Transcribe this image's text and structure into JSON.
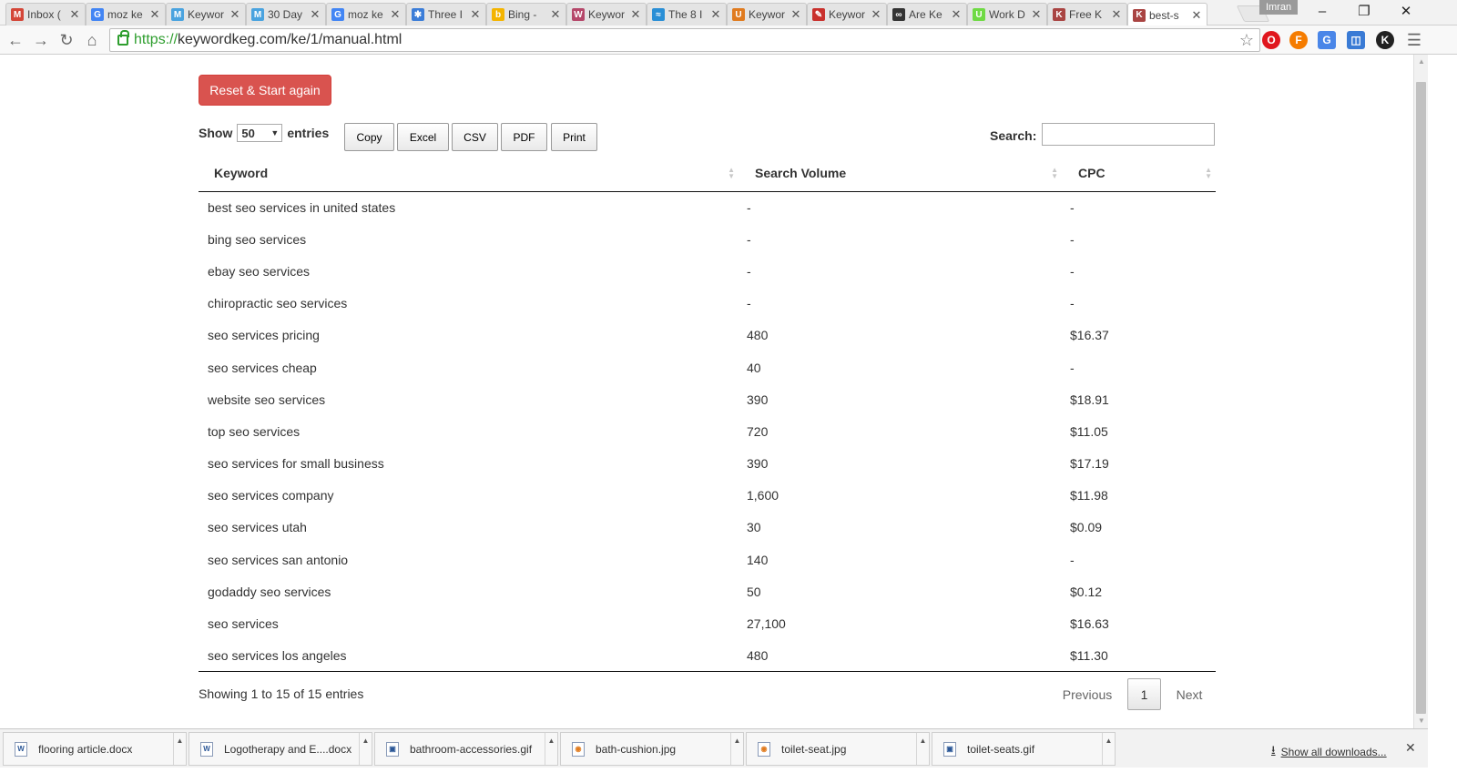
{
  "browser": {
    "tabs": [
      {
        "title": "Inbox (",
        "favicon": "gmail-icon",
        "fav_color": "#d44638",
        "fav_text": "M"
      },
      {
        "title": "moz ke",
        "favicon": "google-icon",
        "fav_color": "#4285f4",
        "fav_text": "G"
      },
      {
        "title": "Keywor",
        "favicon": "moz-icon",
        "fav_color": "#4aa3df",
        "fav_text": "M"
      },
      {
        "title": "30 Day",
        "favicon": "moz-icon",
        "fav_color": "#4aa3df",
        "fav_text": "M"
      },
      {
        "title": "moz ke",
        "favicon": "google-icon",
        "fav_color": "#4285f4",
        "fav_text": "G"
      },
      {
        "title": "Three I",
        "favicon": "gear-icon",
        "fav_color": "#3b7dd8",
        "fav_text": "✱"
      },
      {
        "title": "Bing -",
        "favicon": "bing-icon",
        "fav_color": "#f4b400",
        "fav_text": "b"
      },
      {
        "title": "Keywor",
        "favicon": "ad-icon",
        "fav_color": "#b5476a",
        "fav_text": "W"
      },
      {
        "title": "The 8 I",
        "favicon": "wave-icon",
        "fav_color": "#2a8fd6",
        "fav_text": "≈"
      },
      {
        "title": "Keywor",
        "favicon": "us-icon",
        "fav_color": "#e07b1f",
        "fav_text": "U"
      },
      {
        "title": "Keywor",
        "favicon": "quill-icon",
        "fav_color": "#c9302c",
        "fav_text": "✎"
      },
      {
        "title": "Are Ke",
        "favicon": "dots-icon",
        "fav_color": "#333333",
        "fav_text": "∞"
      },
      {
        "title": "Work D",
        "favicon": "upwork-icon",
        "fav_color": "#6fda44",
        "fav_text": "U"
      },
      {
        "title": "Free K",
        "favicon": "keg-icon",
        "fav_color": "#a94442",
        "fav_text": "K"
      },
      {
        "title": "best-s",
        "favicon": "keg-icon",
        "fav_color": "#a94442",
        "fav_text": "K",
        "active": true
      }
    ],
    "profile_name": "Imran",
    "url_scheme": "https://",
    "url_rest": "keywordkeg.com/ke/1/manual.html"
  },
  "toolbar": {
    "reset_label": "Reset & Start again",
    "show_label": "Show",
    "entries_value": "50",
    "entries_label": "entries",
    "copy_label": "Copy",
    "excel_label": "Excel",
    "csv_label": "CSV",
    "pdf_label": "PDF",
    "print_label": "Print",
    "search_label": "Search:"
  },
  "table": {
    "columns": [
      "Keyword",
      "Search Volume",
      "CPC"
    ],
    "rows": [
      [
        "best seo services in united states",
        "-",
        "-"
      ],
      [
        "bing seo services",
        "-",
        "-"
      ],
      [
        "ebay seo services",
        "-",
        "-"
      ],
      [
        "chiropractic seo services",
        "-",
        "-"
      ],
      [
        "seo services pricing",
        "480",
        "$16.37"
      ],
      [
        "seo services cheap",
        "40",
        "-"
      ],
      [
        "website seo services",
        "390",
        "$18.91"
      ],
      [
        "top seo services",
        "720",
        "$11.05"
      ],
      [
        "seo services for small business",
        "390",
        "$17.19"
      ],
      [
        "seo services company",
        "1,600",
        "$11.98"
      ],
      [
        "seo services utah",
        "30",
        "$0.09"
      ],
      [
        "seo services san antonio",
        "140",
        "-"
      ],
      [
        "godaddy seo services",
        "50",
        "$0.12"
      ],
      [
        "seo services",
        "27,100",
        "$16.63"
      ],
      [
        "seo services los angeles",
        "480",
        "$11.30"
      ]
    ]
  },
  "footer": {
    "info": "Showing 1 to 15 of 15 entries",
    "previous": "Previous",
    "current_page": "1",
    "next": "Next"
  },
  "downloads": {
    "items": [
      {
        "name": "flooring article.docx",
        "type": "word"
      },
      {
        "name": "Logotherapy and E....docx",
        "type": "word"
      },
      {
        "name": "bathroom-accessories.gif",
        "type": "image"
      },
      {
        "name": "bath-cushion.jpg",
        "type": "photo"
      },
      {
        "name": "toilet-seat.jpg",
        "type": "photo"
      },
      {
        "name": "toilet-seats.gif",
        "type": "image"
      }
    ],
    "show_all": "Show all downloads..."
  }
}
